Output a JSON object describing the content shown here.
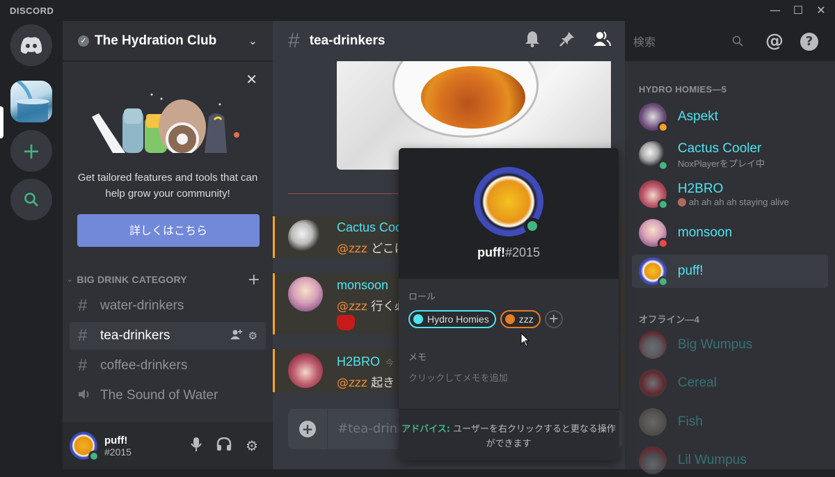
{
  "window": {
    "brand": "DISCORD",
    "minimize": "—",
    "maximize": "☐",
    "close": "✕"
  },
  "rail": {
    "home_icon": "discord-logo-icon",
    "servers": [
      {
        "name": "The Hydration Club",
        "icon": "water-glass-image",
        "active": true
      }
    ],
    "add_server": "+",
    "explore": "⌕"
  },
  "guild": {
    "name": "The Hydration Club",
    "verified_mark": "✓",
    "dropdown": "⌄"
  },
  "promo": {
    "close": "✕",
    "text": "Get tailored features and tools that can help grow your community!",
    "button": "詳しくはこちら"
  },
  "category": {
    "name": "BIG DRINK CATEGORY",
    "collapse_icon": "⌄",
    "add": "+"
  },
  "channels": [
    {
      "type": "text",
      "icon": "#",
      "name": "water-drinkers",
      "selected": false
    },
    {
      "type": "text",
      "icon": "#",
      "name": "tea-drinkers",
      "selected": true,
      "actions": [
        "👤+",
        "⚙"
      ]
    },
    {
      "type": "text",
      "icon": "#",
      "name": "coffee-drinkers",
      "selected": false
    },
    {
      "type": "voice",
      "icon": "🔈",
      "name": "The Sound of Water",
      "selected": false
    }
  ],
  "user": {
    "name": "puff!",
    "tag": "#2015",
    "status": "online",
    "mic": "🎙",
    "headset": "🎧",
    "settings": "⚙"
  },
  "header": {
    "channel_hash": "#",
    "channel_name": "tea-drinkers",
    "search_placeholder": "検索",
    "search_icon": "⌕",
    "icons": {
      "bell": "🔔",
      "pin": "📌",
      "members": "👥",
      "mention": "@",
      "help": "?"
    }
  },
  "messages": [
    {
      "author": "Cactus Cooler",
      "mention": "@zzz",
      "text": "どこに",
      "time": ""
    },
    {
      "author": "monsoon",
      "mention": "@zzz",
      "text": "行く必",
      "time": "",
      "emoji": "😈"
    },
    {
      "author": "H2BRO",
      "mention": "@zzz",
      "text": "起き",
      "time": "今"
    }
  ],
  "composer": {
    "add": "+",
    "placeholder": "#tea-drink"
  },
  "popout": {
    "username": "puff!",
    "discriminator": "#2015",
    "status": "online",
    "roles_label": "ロール",
    "roles": [
      {
        "name": "Hydro Homies",
        "color": "#4ee5ef"
      },
      {
        "name": "zzz",
        "color": "#e67e22"
      }
    ],
    "add_role": "+",
    "note_label": "メモ",
    "note_placeholder": "クリックしてメモを追加",
    "tip_label": "アドバイス:",
    "tip_text": "ユーザーを右クリックすると更なる操作ができます"
  },
  "members": {
    "online_group": "HYDRO HOMIES—5",
    "online": [
      {
        "name": "Aspekt",
        "status": "idle",
        "activity": ""
      },
      {
        "name": "Cactus Cooler",
        "status": "online",
        "activity": "NoxPlayerをプレイ中"
      },
      {
        "name": "H2BRO",
        "status": "online",
        "activity": "ah ah ah ah staying alive"
      },
      {
        "name": "monsoon",
        "status": "dnd",
        "activity": ""
      },
      {
        "name": "puff!",
        "status": "online",
        "activity": "",
        "selected": true
      }
    ],
    "offline_group": "オフライン—4",
    "offline": [
      {
        "name": "Big Wumpus"
      },
      {
        "name": "Cereal"
      },
      {
        "name": "Fish"
      },
      {
        "name": "Lil Wumpus"
      }
    ]
  },
  "colors": {
    "accent": "#7289da",
    "online": "#43b581",
    "idle": "#faa61a",
    "dnd": "#f04747",
    "role_cyan": "#4ee5ef",
    "mention": "#ec8c3a"
  }
}
